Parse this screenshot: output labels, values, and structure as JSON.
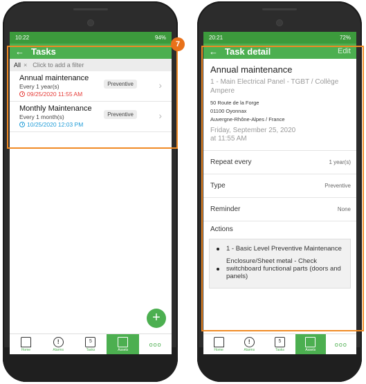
{
  "step_number": "7",
  "left": {
    "status": {
      "time": "10:22",
      "right": "94%"
    },
    "title": "Tasks",
    "filter": {
      "chip": "All",
      "chip_remove": "×",
      "placeholder": "Click to add a filter"
    },
    "tasks": [
      {
        "name": "Annual maintenance",
        "frequency": "Every 1 year(s)",
        "due": "09/25/2020 11:55 AM",
        "due_color": "#e53935",
        "type": "Preventive"
      },
      {
        "name": "Monthly Maintenance",
        "frequency": "Every 1 month(s)",
        "due": "10/25/2020 12:03 PM",
        "due_color": "#1e9bd7",
        "type": "Preventive"
      }
    ]
  },
  "right": {
    "status": {
      "time": "20:21",
      "right": "72%"
    },
    "title": "Task detail",
    "edit": "Edit",
    "task_title": "Annual maintenance",
    "location": "1 - Main Electrical Panel - TGBT / Collège Ampere",
    "address": [
      "50 Route de la Forge",
      "01100 Oyonnax",
      "Auvergne-Rhône-Alpes / France"
    ],
    "date": [
      "Friday, September 25, 2020",
      "at 11:55 AM"
    ],
    "rows": [
      {
        "label": "Repeat every",
        "value": "1 year(s)"
      },
      {
        "label": "Type",
        "value": "Preventive"
      },
      {
        "label": "Reminder",
        "value": "None"
      }
    ],
    "actions_label": "Actions",
    "actions": [
      "1 - Basic Level Preventive Maintenance",
      "Enclosure/Sheet metal - Check switchboard functional parts (doors and panels)"
    ]
  },
  "nav": {
    "items": [
      {
        "label": "Home",
        "icon": "home-icon"
      },
      {
        "label": "Alarms",
        "icon": "alarm-icon"
      },
      {
        "label": "Tasks",
        "icon": "tasks-icon"
      },
      {
        "label": "Assets",
        "icon": "assets-icon"
      }
    ],
    "more": "ooo"
  },
  "colors": {
    "accent": "#4caf50",
    "highlight": "#f08a24",
    "overdue": "#e53935",
    "upcoming": "#1e9bd7"
  }
}
